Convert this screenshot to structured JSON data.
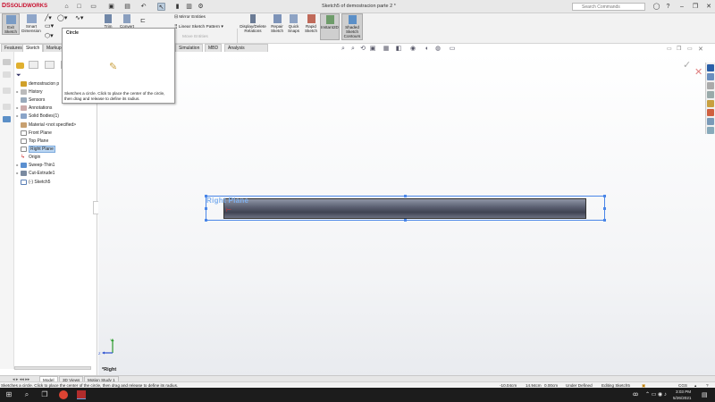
{
  "app": {
    "logo_ds": "DS",
    "logo_text": "SOLIDWORKS",
    "doc_title": "Sketch5 of demostracion parte 2 *"
  },
  "search": {
    "placeholder": "Search Commands"
  },
  "ribbon": {
    "exit_sketch": "Exit Sketch",
    "smart_dimension": "Smart Dimension",
    "trim": "Trim",
    "convert": "Convert",
    "mirror": "Mirror Entities",
    "linear_pattern": "Linear Sketch Pattern",
    "move": "Move Entities",
    "display_delete": "Display/Delete Relations",
    "repair": "Repair Sketch",
    "quick_snaps": "Quick Snaps",
    "rapid_sketch": "Rapid Sketch",
    "instant2d": "Instant2D",
    "shaded_contours": "Shaded Sketch Contours"
  },
  "tabs": [
    "Features",
    "Sketch",
    "Markup",
    "Simulation",
    "MBD",
    "Analysis Preparation"
  ],
  "popup": {
    "title": "Circle",
    "description": "Sketches a circle. Click to place the center of the circle, then drag and release to define its radius."
  },
  "tree": [
    {
      "label": "demostracion p",
      "arrow": ""
    },
    {
      "label": "History",
      "arrow": "▸"
    },
    {
      "label": "Sensors",
      "arrow": ""
    },
    {
      "label": "Annotations",
      "arrow": "▸"
    },
    {
      "label": "Solid Bodies(1)",
      "arrow": "▸"
    },
    {
      "label": "Material <not specified>",
      "arrow": ""
    },
    {
      "label": "Front Plane",
      "arrow": ""
    },
    {
      "label": "Top Plane",
      "arrow": ""
    },
    {
      "label": "Right Plane",
      "arrow": ""
    },
    {
      "label": "Origin",
      "arrow": ""
    },
    {
      "label": "Sweep-Thin1",
      "arrow": "▸"
    },
    {
      "label": "Cut-Extrude1",
      "arrow": "▸"
    },
    {
      "label": "(-) Sketch5",
      "arrow": ""
    }
  ],
  "viewport": {
    "plane_label": "Right Plane",
    "view_label": "*Right",
    "triad_y": "Y",
    "triad_z": "Z"
  },
  "bottom_tabs": [
    "Model",
    "3D Views",
    "Motion Study 1"
  ],
  "status": {
    "message": "Sketches a circle. Click to place the center of the circle, then drag and release to define its radius.",
    "x": "-10.04cm",
    "y": "14.94cm",
    "z": "0.00cm",
    "defined": "Under Defined",
    "editing": "Editing Sketch5",
    "units": "CGS"
  },
  "taskbar": {
    "time": "3:03 PM",
    "date": "5/26/2021"
  },
  "colors": {
    "accent": "#4a86e8",
    "logo": "#c8102e",
    "selection": "#bcd7f3"
  }
}
